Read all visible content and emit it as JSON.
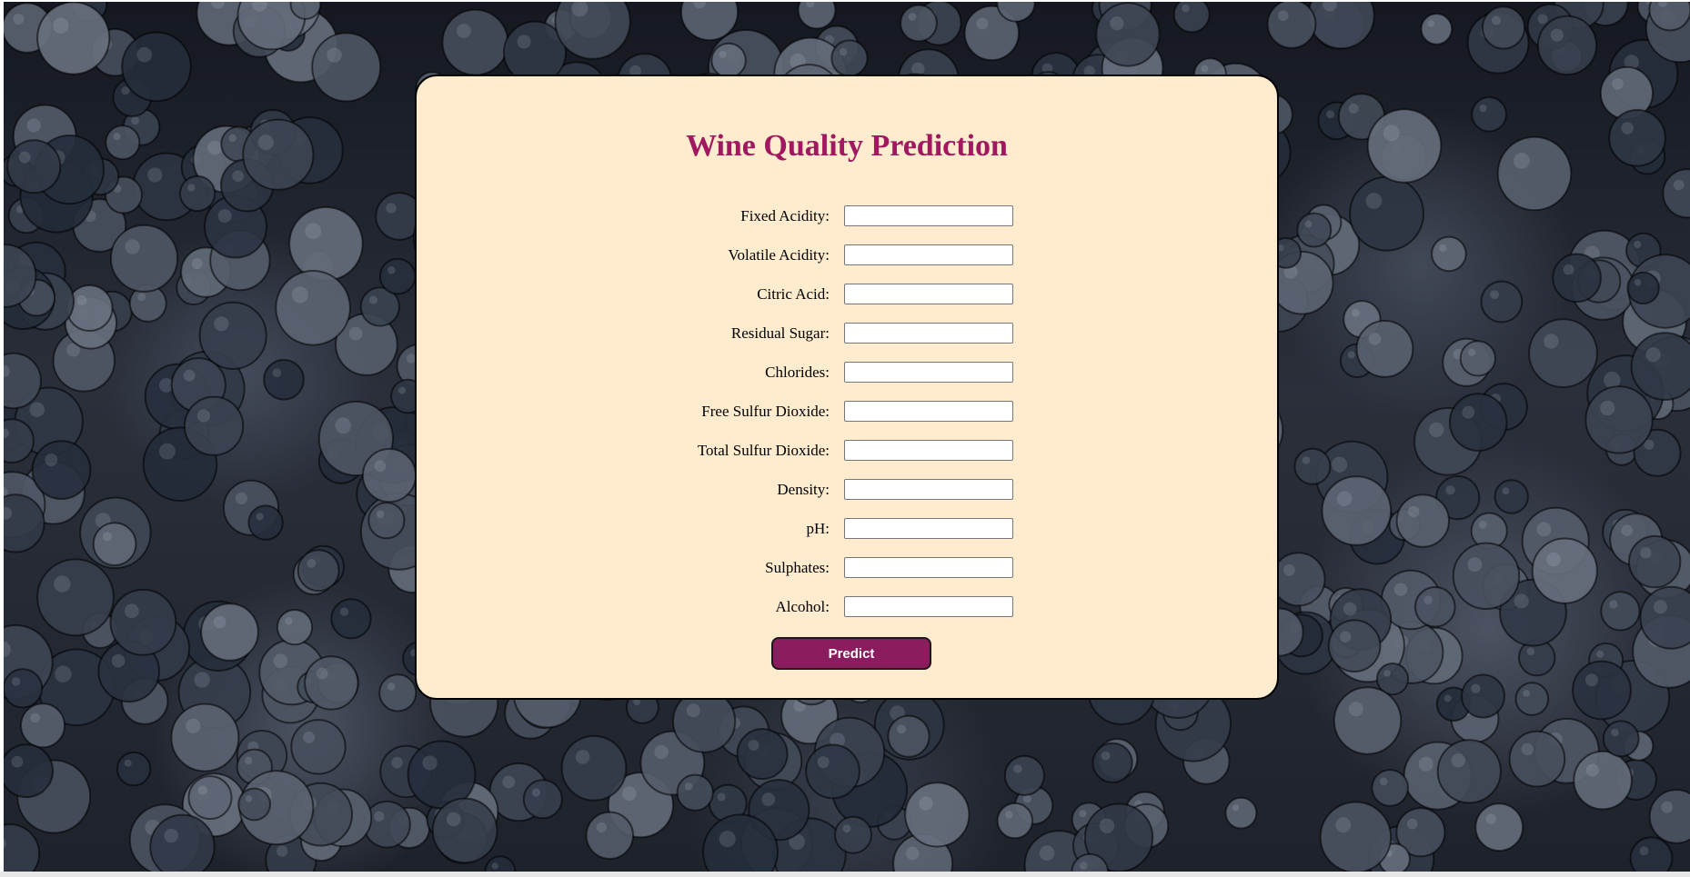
{
  "page": {
    "title": "Wine Quality Prediction"
  },
  "form": {
    "fields": [
      {
        "label": "Fixed Acidity:",
        "value": ""
      },
      {
        "label": "Volatile Acidity:",
        "value": ""
      },
      {
        "label": "Citric Acid:",
        "value": ""
      },
      {
        "label": "Residual Sugar:",
        "value": ""
      },
      {
        "label": "Chlorides:",
        "value": ""
      },
      {
        "label": "Free Sulfur Dioxide:",
        "value": ""
      },
      {
        "label": "Total Sulfur Dioxide:",
        "value": ""
      },
      {
        "label": "Density:",
        "value": ""
      },
      {
        "label": "pH:",
        "value": ""
      },
      {
        "label": "Sulphates:",
        "value": ""
      },
      {
        "label": "Alcohol:",
        "value": ""
      }
    ],
    "submit_label": "Predict"
  },
  "colors": {
    "card_background": "#ffebcd",
    "title_color": "#a0185f",
    "button_color": "#8b1c5e"
  },
  "background": {
    "icon": "grapes-photo-background"
  }
}
